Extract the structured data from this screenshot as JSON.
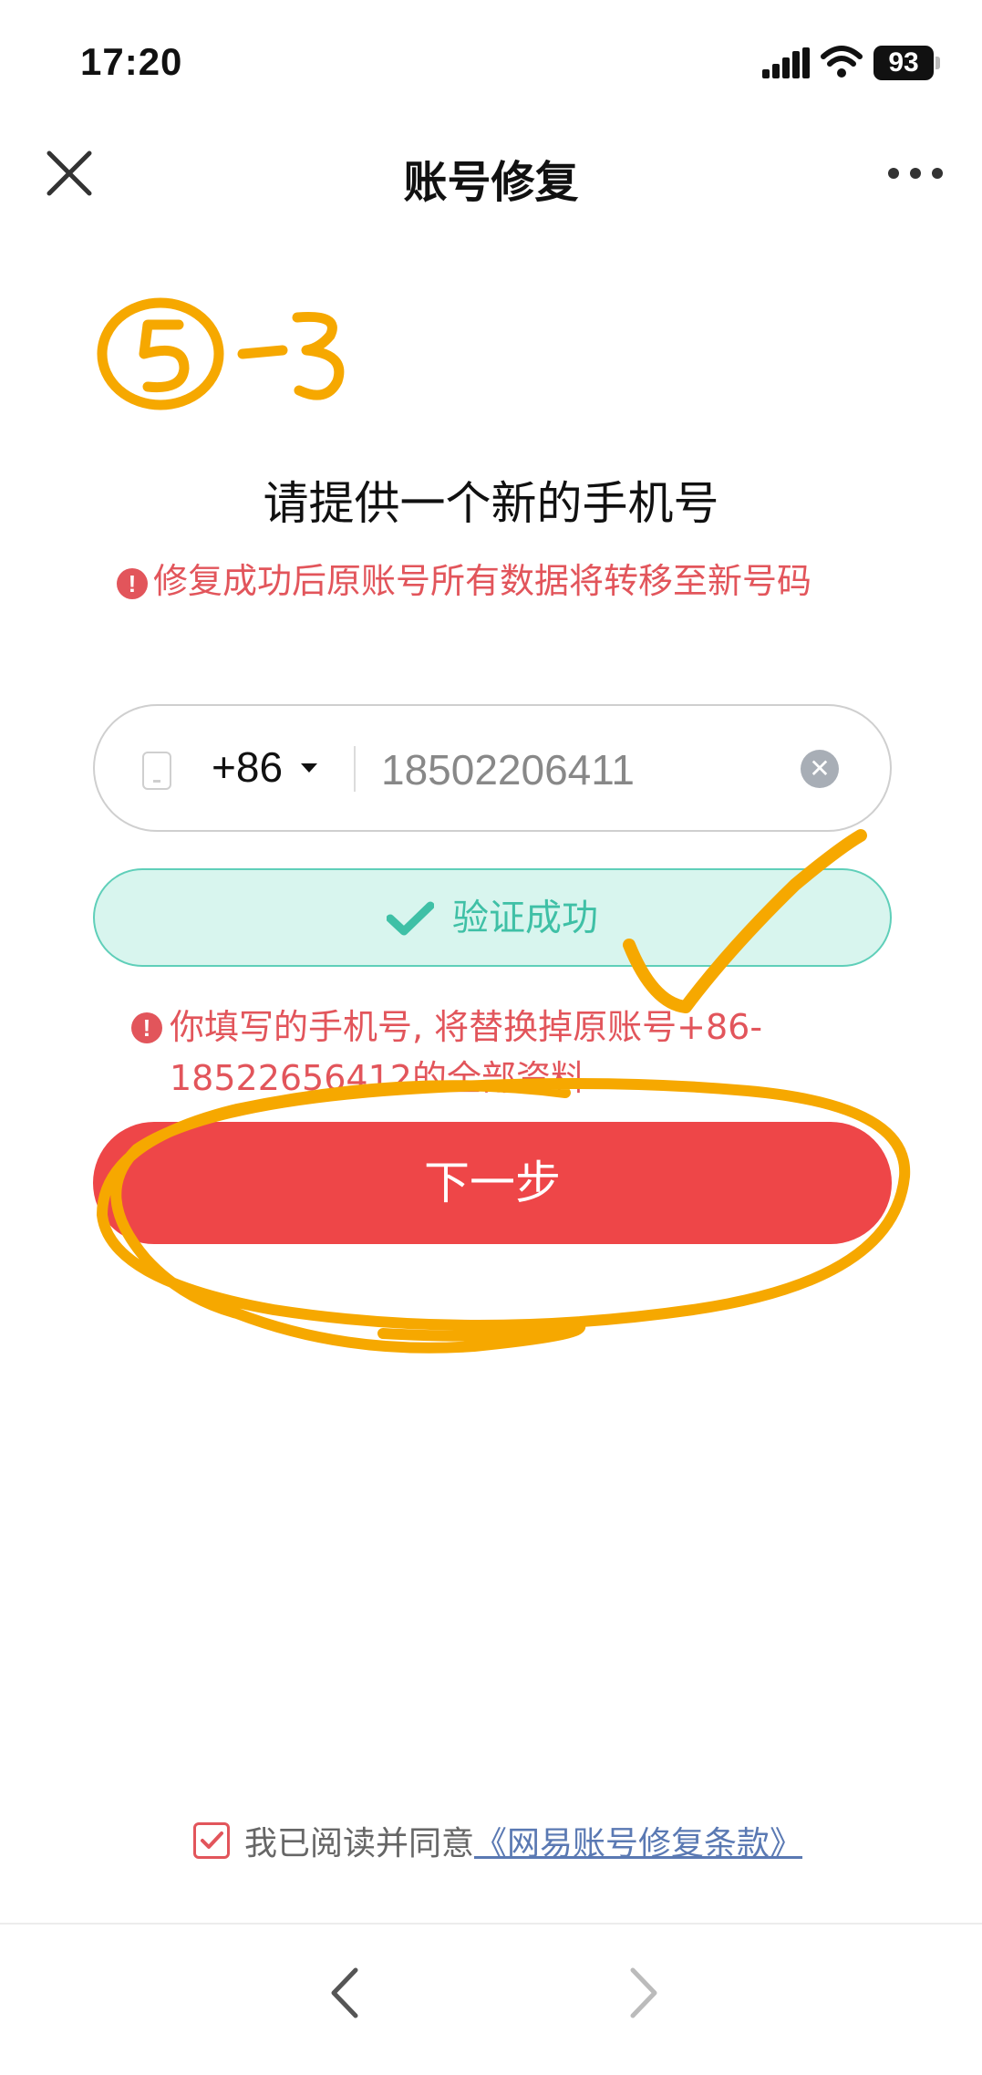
{
  "status_bar": {
    "time": "17:20",
    "battery": "93"
  },
  "nav": {
    "title": "账号修复"
  },
  "annotation_label": "5-3",
  "heading": "请提供一个新的手机号",
  "warning_top": "修复成功后原账号所有数据将转移至新号码",
  "phone": {
    "country_code": "+86",
    "value": "18502206411"
  },
  "verify": {
    "text": "验证成功"
  },
  "warning_replace": "你填写的手机号, 将替换掉原账号+86-18522656412的全部资料",
  "next_button": "下一步",
  "agreement": {
    "text": "我已阅读并同意",
    "link": "《网易账号修复条款》",
    "checked": true
  },
  "colors": {
    "primary_red": "#ee4648",
    "warning_red": "#e2555b",
    "success_green": "#3fc0a6",
    "annotation_orange": "#f6a800"
  }
}
